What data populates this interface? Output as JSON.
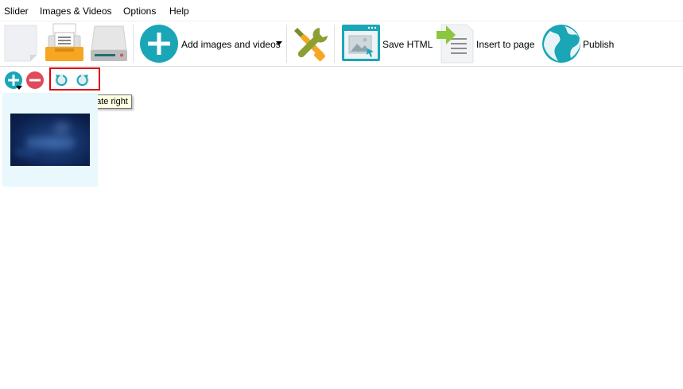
{
  "menu": {
    "items": [
      "Slider",
      "Images & Videos",
      "Options",
      "Help"
    ]
  },
  "toolbar": {
    "add_label": "Add images and videos",
    "save_html_label": "Save HTML",
    "insert_label": "Insert to page",
    "publish_label": "Publish"
  },
  "subbar": {
    "tooltip": "Rotate right"
  },
  "colors": {
    "teal": "#1aa6b7",
    "red": "#e04a5a",
    "orange": "#f5a623",
    "highlight": "#e00000"
  }
}
